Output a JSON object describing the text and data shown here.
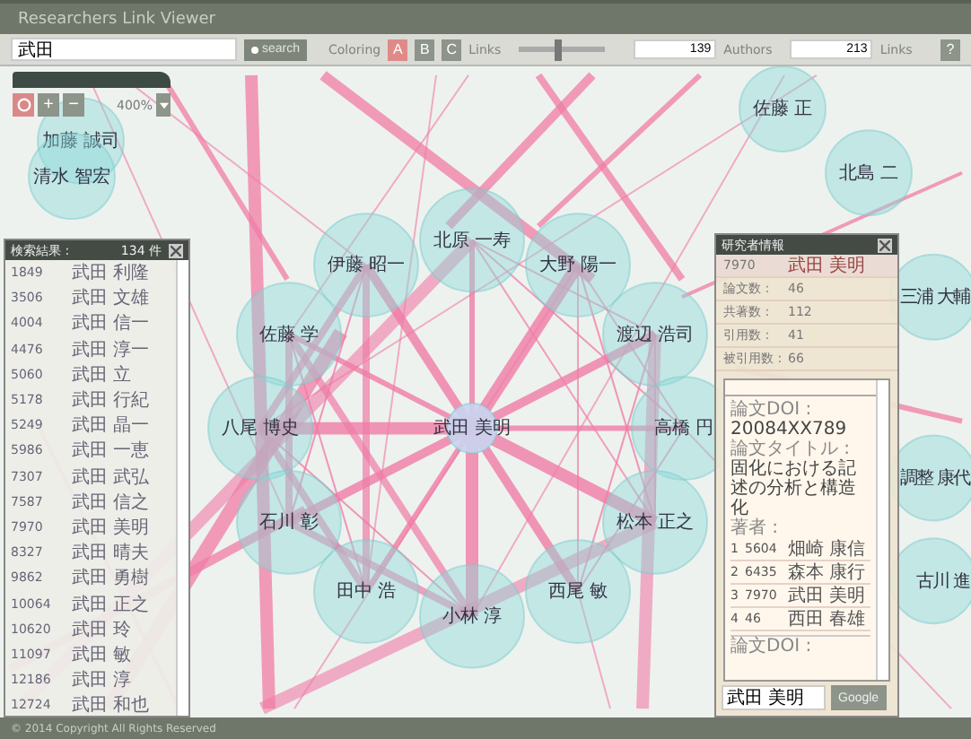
{
  "window": {
    "title": "Researchers Link Viewer"
  },
  "toolbar": {
    "search_value": "武田",
    "search_button": "search",
    "coloring_label": "Coloring",
    "color_modes": [
      {
        "label": "A",
        "selected": true
      },
      {
        "label": "B",
        "selected": false
      },
      {
        "label": "C",
        "selected": false
      }
    ],
    "slider": {
      "label": "Links",
      "level": 0.45
    },
    "min_value": "139",
    "min_label": "Authors",
    "max_value": "213",
    "max_label": "Links",
    "help": "?"
  },
  "zoom": {
    "plus": "+",
    "minus": "−",
    "value": "400%"
  },
  "network": {
    "nodes": [
      {
        "label": "北原 一寿",
        "kind": "ring"
      },
      {
        "label": "伊藤 昭一",
        "kind": "ring"
      },
      {
        "label": "大野 陽一",
        "kind": "ring"
      },
      {
        "label": "佐藤 学",
        "kind": "ring"
      },
      {
        "label": "渡辺 浩司",
        "kind": "ring"
      },
      {
        "label": "八尾 博史",
        "kind": "ring"
      },
      {
        "label": "高橋 円",
        "kind": "ring"
      },
      {
        "label": "石川 彰",
        "kind": "ring"
      },
      {
        "label": "松本 正之",
        "kind": "ring"
      },
      {
        "label": "田中 浩",
        "kind": "ring"
      },
      {
        "label": "西尾 敏",
        "kind": "ring"
      },
      {
        "label": "小林 淳",
        "kind": "ring"
      },
      {
        "label": "佐藤 正",
        "kind": "outer"
      },
      {
        "label": "北島 二",
        "kind": "outer"
      },
      {
        "label": "三浦 大輔",
        "kind": "outer"
      },
      {
        "label": "調整 康代",
        "kind": "outer"
      },
      {
        "label": "古川 進",
        "kind": "outer"
      },
      {
        "label": "加藤 誠司",
        "kind": "outer"
      },
      {
        "label": "清水 智宏",
        "kind": "outer"
      },
      {
        "label": "武田 美明",
        "kind": "focus"
      }
    ]
  },
  "results": {
    "title": "検索結果 :",
    "count": "134 件",
    "rows": [
      {
        "id": "1849",
        "name": "武田 利隆"
      },
      {
        "id": "3506",
        "name": "武田 文雄"
      },
      {
        "id": "4004",
        "name": "武田 信一"
      },
      {
        "id": "4476",
        "name": "武田 淳一"
      },
      {
        "id": "5060",
        "name": "武田 立"
      },
      {
        "id": "5178",
        "name": "武田 行紀"
      },
      {
        "id": "5249",
        "name": "武田 晶一"
      },
      {
        "id": "5986",
        "name": "武田 一恵"
      },
      {
        "id": "7307",
        "name": "武田 武弘"
      },
      {
        "id": "7587",
        "name": "武田 信之"
      },
      {
        "id": "7970",
        "name": "武田 美明"
      },
      {
        "id": "8327",
        "name": "武田 晴夫"
      },
      {
        "id": "9862",
        "name": "武田 勇樹"
      },
      {
        "id": "10064",
        "name": "武田 正之"
      },
      {
        "id": "10620",
        "name": "武田 玲"
      },
      {
        "id": "11097",
        "name": "武田 敏"
      },
      {
        "id": "12186",
        "name": "武田 淳"
      },
      {
        "id": "12724",
        "name": "武田 和也"
      }
    ]
  },
  "info": {
    "title": "研究者情報",
    "id": "7970",
    "name": "武田 美明",
    "stats": [
      {
        "label": "論文数 :",
        "value": "46"
      },
      {
        "label": "共著数 :",
        "value": "112"
      },
      {
        "label": "引用数 :",
        "value": "41"
      },
      {
        "label": "被引用数 :",
        "value": "66"
      }
    ],
    "details": [
      {
        "kind": "label",
        "text": "論文DOI :"
      },
      {
        "kind": "value",
        "text": "20084XX789"
      },
      {
        "kind": "label",
        "text": "論文タイトル :"
      },
      {
        "kind": "value",
        "text": "固化における記述の分析と構造化"
      },
      {
        "kind": "label",
        "text": "著者 :"
      }
    ],
    "authors": [
      {
        "no": "1",
        "id": "5604",
        "name": "畑崎 康信"
      },
      {
        "no": "2",
        "id": "6435",
        "name": "森本 康行"
      },
      {
        "no": "3",
        "id": "7970",
        "name": "武田 美明"
      },
      {
        "no": "4",
        "id": "46",
        "name": "西田 春雄"
      }
    ],
    "details_end": {
      "kind": "label",
      "text": "論文DOI :"
    },
    "search_value": "武田 美明",
    "search_button": "Google"
  },
  "footer": "© 2014 Copyright All Rights Reserved"
}
